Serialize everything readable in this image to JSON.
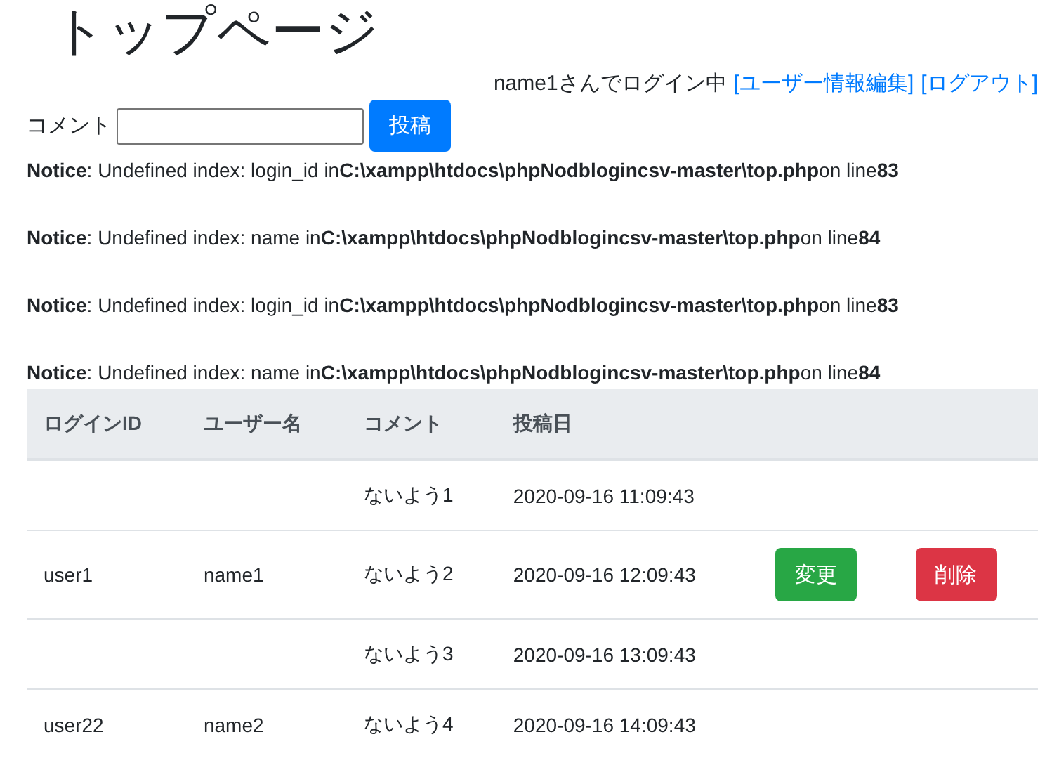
{
  "page_title": "トップページ",
  "login_status": {
    "text": "name1さんでログイン中",
    "links": [
      "[ユーザー情報編集]",
      "[ログアウト]"
    ]
  },
  "comment_form": {
    "label": "コメント",
    "submit": "投稿"
  },
  "notices": [
    "**Notice**: Undefined index: login_id in**C:\\xampp\\htdocs\\phpNodblogincsv-master\\top.php**on line**83**",
    "**Notice**: Undefined index: name in**C:\\xampp\\htdocs\\phpNodblogincsv-master\\top.php**on line**84**",
    "**Notice**: Undefined index: login_id in**C:\\xampp\\htdocs\\phpNodblogincsv-master\\top.php**on line**83**",
    "**Notice**: Undefined index: name in**C:\\xampp\\htdocs\\phpNodblogincsv-master\\top.php**on line**84**"
  ],
  "table": {
    "columns": [
      "ログインID",
      "ユーザー名",
      "コメント",
      "投稿日"
    ],
    "rows": [
      {
        "login_id": "",
        "user_name": "",
        "comment": "ないよう1",
        "posted": "2020-09-16 11:09:43",
        "buttons": []
      },
      {
        "login_id": "user1",
        "user_name": "name1",
        "comment": "ないよう2",
        "posted": "2020-09-16 12:09:43",
        "buttons": [
          {
            "kind": "edit",
            "label": "変更"
          },
          {
            "kind": "delete",
            "label": "削除"
          }
        ]
      },
      {
        "login_id": "",
        "user_name": "",
        "comment": "ないよう3",
        "posted": "2020-09-16 13:09:43",
        "buttons": []
      },
      {
        "login_id": "user22",
        "user_name": "name2",
        "comment": "ないよう4",
        "posted": "2020-09-16 14:09:43",
        "buttons": []
      }
    ]
  }
}
